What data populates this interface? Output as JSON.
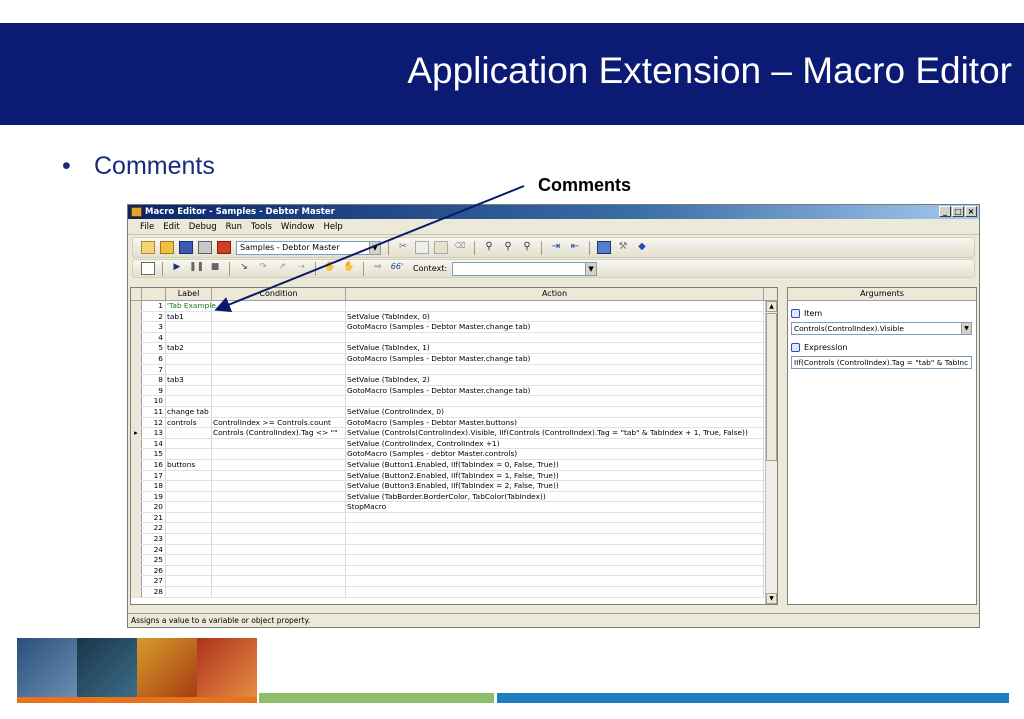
{
  "slide": {
    "title": "Application Extension – Macro Editor",
    "bullet": "Comments",
    "callout": "Comments"
  },
  "window": {
    "title": "Macro Editor - Samples - Debtor Master",
    "controls": [
      "_",
      "□",
      "×"
    ],
    "menu": [
      "File",
      "Edit",
      "Debug",
      "Run",
      "Tools",
      "Window",
      "Help"
    ],
    "macro_combo": "Samples - Debtor Master",
    "context_label": "Context:",
    "context_value": ""
  },
  "grid": {
    "columns": [
      "Label",
      "Condition",
      "Action"
    ],
    "rows": [
      {
        "n": "1",
        "label": "'Tab Example",
        "cond": "",
        "act": "",
        "comment": true
      },
      {
        "n": "2",
        "label": "tab1",
        "cond": "",
        "act": "SetValue (TabIndex, 0)"
      },
      {
        "n": "3",
        "label": "",
        "cond": "",
        "act": "GotoMacro (Samples - Debtor Master.change tab)"
      },
      {
        "n": "4",
        "label": "",
        "cond": "",
        "act": ""
      },
      {
        "n": "5",
        "label": "tab2",
        "cond": "",
        "act": "SetValue (TabIndex, 1)"
      },
      {
        "n": "6",
        "label": "",
        "cond": "",
        "act": "GotoMacro (Samples - Debtor Master.change tab)"
      },
      {
        "n": "7",
        "label": "",
        "cond": "",
        "act": ""
      },
      {
        "n": "8",
        "label": "tab3",
        "cond": "",
        "act": "SetValue (TabIndex, 2)"
      },
      {
        "n": "9",
        "label": "",
        "cond": "",
        "act": "GotoMacro (Samples - Debtor Master.change tab)"
      },
      {
        "n": "10",
        "label": "",
        "cond": "",
        "act": ""
      },
      {
        "n": "11",
        "label": "change tab",
        "cond": "",
        "act": "SetValue (ControlIndex, 0)"
      },
      {
        "n": "12",
        "label": "controls",
        "cond": "ControlIndex >= Controls.count",
        "act": "GotoMacro (Samples - Debtor Master.buttons)"
      },
      {
        "n": "13",
        "label": "",
        "cond": "Controls (ControlIndex).Tag <> \"\"",
        "act": "SetValue (Controls(ControlIndex).Visible, IIf(Controls (ControlIndex).Tag = \"tab\" & TabIndex + 1, True, False))",
        "current": true
      },
      {
        "n": "14",
        "label": "",
        "cond": "",
        "act": "SetValue (ControlIndex, ControlIndex +1)"
      },
      {
        "n": "15",
        "label": "",
        "cond": "",
        "act": "GotoMacro (Samples - debtor Master.controls)"
      },
      {
        "n": "16",
        "label": "buttons",
        "cond": "",
        "act": "SetValue (Button1.Enabled, IIf(TabIndex = 0, False, True))"
      },
      {
        "n": "17",
        "label": "",
        "cond": "",
        "act": "SetValue (Button2.Enabled, IIf(TabIndex = 1, False, True))"
      },
      {
        "n": "18",
        "label": "",
        "cond": "",
        "act": "SetValue (Button3.Enabled, IIf(TabIndex = 2, False, True))"
      },
      {
        "n": "19",
        "label": "",
        "cond": "",
        "act": "SetValue (TabBorder.BorderColor, TabColor(TabIndex))"
      },
      {
        "n": "20",
        "label": "",
        "cond": "",
        "act": "StopMacro"
      },
      {
        "n": "21",
        "label": "",
        "cond": "",
        "act": ""
      },
      {
        "n": "22",
        "label": "",
        "cond": "",
        "act": ""
      },
      {
        "n": "23",
        "label": "",
        "cond": "",
        "act": ""
      },
      {
        "n": "24",
        "label": "",
        "cond": "",
        "act": ""
      },
      {
        "n": "25",
        "label": "",
        "cond": "",
        "act": ""
      },
      {
        "n": "26",
        "label": "",
        "cond": "",
        "act": ""
      },
      {
        "n": "27",
        "label": "",
        "cond": "",
        "act": ""
      },
      {
        "n": "28",
        "label": "",
        "cond": "",
        "act": ""
      }
    ]
  },
  "arguments": {
    "header": "Arguments",
    "item_label": "Item",
    "item_value": "Controls(ControlIndex).Visible",
    "expression_label": "Expression",
    "expression_value": "IIf(Controls (ControlIndex).Tag = \"tab\" & TabInc"
  },
  "status": "Assigns a value to a variable or object property.",
  "colors": {
    "header_bg": "#0b1a73",
    "comment_green": "#1a7a1a",
    "stripe_orange": "#e8731f",
    "stripe_green": "#8dbf6a",
    "stripe_blue": "#1c80c0"
  }
}
